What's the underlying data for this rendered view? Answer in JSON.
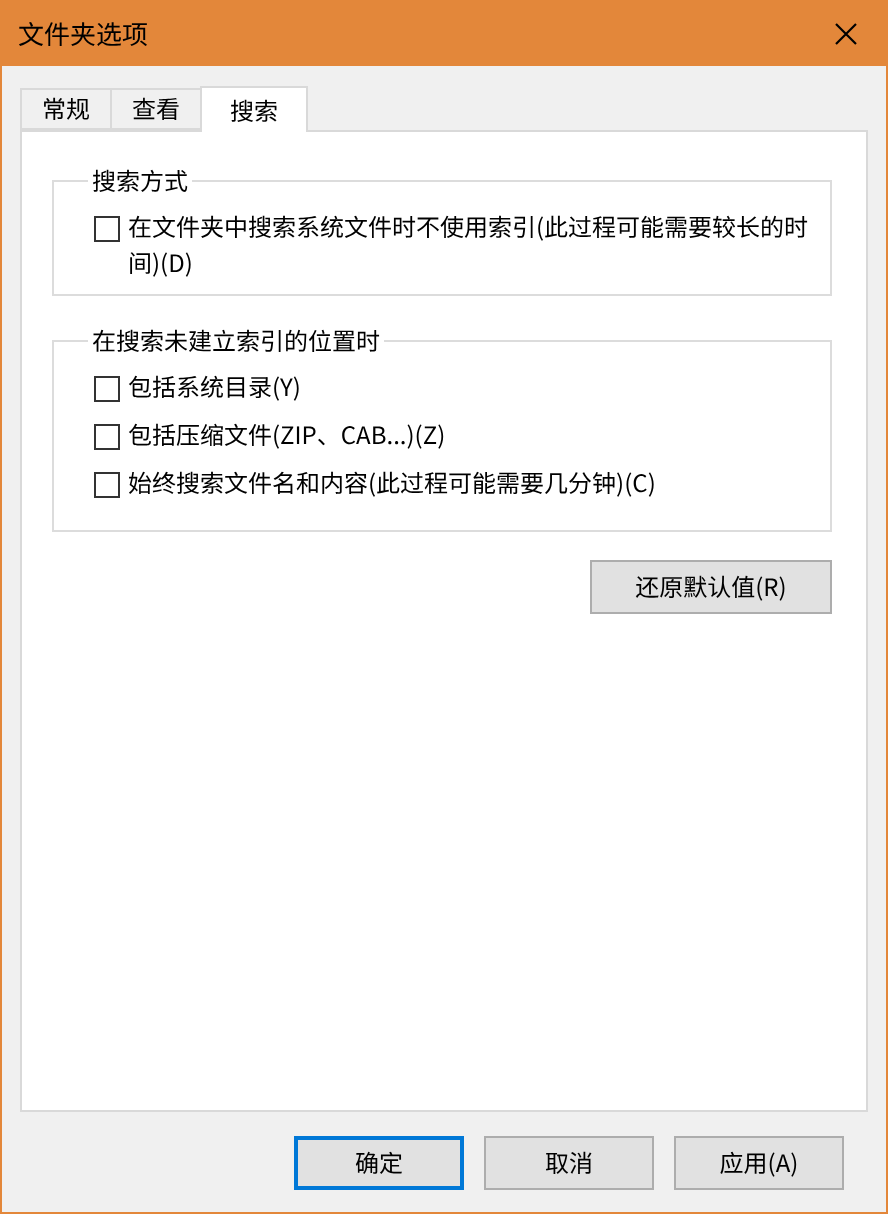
{
  "window": {
    "title": "文件夹选项"
  },
  "tabs": [
    {
      "label": "常规",
      "selected": false
    },
    {
      "label": "查看",
      "selected": false
    },
    {
      "label": "搜索",
      "selected": true
    }
  ],
  "groups": [
    {
      "title": "搜索方式",
      "options": [
        {
          "label": "在文件夹中搜索系统文件时不使用索引(此过程可能需要较长的时间)(D)",
          "checked": false
        }
      ]
    },
    {
      "title": "在搜索未建立索引的位置时",
      "options": [
        {
          "label": "包括系统目录(Y)",
          "checked": false
        },
        {
          "label": "包括压缩文件(ZIP、CAB...)(Z)",
          "checked": false
        },
        {
          "label": "始终搜索文件名和内容(此过程可能需要几分钟)(C)",
          "checked": false
        }
      ]
    }
  ],
  "restore_button": "还原默认值(R)",
  "buttons": [
    {
      "label": "确定",
      "default": true
    },
    {
      "label": "取消",
      "default": false
    },
    {
      "label": "应用(A)",
      "default": false
    }
  ]
}
